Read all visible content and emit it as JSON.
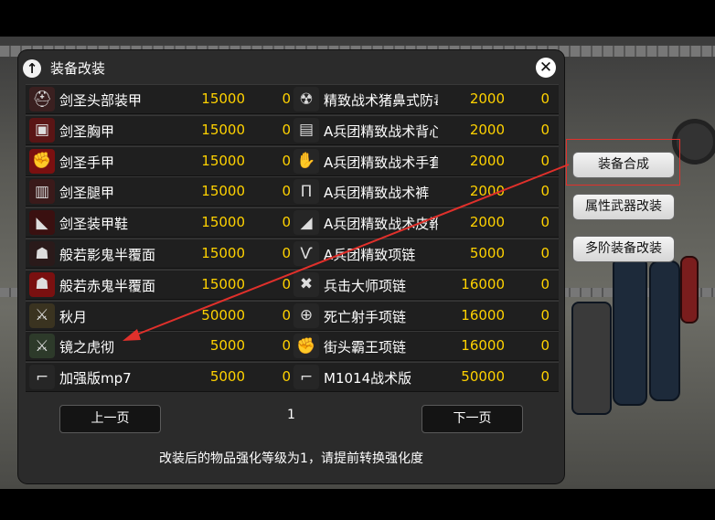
{
  "panel": {
    "title": "装备改装",
    "back_icon": "arrow-up-icon",
    "close_icon": "close-icon"
  },
  "left_items": [
    {
      "name": "剑圣头部装甲",
      "price": "15000",
      "count": "0",
      "icon": "helmet-icon"
    },
    {
      "name": "剑圣胸甲",
      "price": "15000",
      "count": "0",
      "icon": "chest-armor-icon"
    },
    {
      "name": "剑圣手甲",
      "price": "15000",
      "count": "0",
      "icon": "gauntlet-icon"
    },
    {
      "name": "剑圣腿甲",
      "price": "15000",
      "count": "0",
      "icon": "leg-armor-icon"
    },
    {
      "name": "剑圣装甲鞋",
      "price": "15000",
      "count": "0",
      "icon": "boots-icon"
    },
    {
      "name": "般若影鬼半覆面",
      "price": "15000",
      "count": "0",
      "icon": "mask-icon"
    },
    {
      "name": "般若赤鬼半覆面",
      "price": "15000",
      "count": "0",
      "icon": "red-mask-icon"
    },
    {
      "name": "秋月",
      "price": "50000",
      "count": "0",
      "icon": "sword-icon"
    },
    {
      "name": "镜之虎彻",
      "price": "5000",
      "count": "0",
      "icon": "katana-icon"
    },
    {
      "name": "加强版mp7",
      "price": "5000",
      "count": "0",
      "icon": "smg-icon"
    }
  ],
  "right_items": [
    {
      "name": "精致战术猪鼻式防毒",
      "price": "2000",
      "count": "0",
      "icon": "gas-mask-icon"
    },
    {
      "name": "A兵团精致战术背心",
      "price": "2000",
      "count": "0",
      "icon": "vest-icon"
    },
    {
      "name": "A兵团精致战术手套",
      "price": "2000",
      "count": "0",
      "icon": "glove-icon"
    },
    {
      "name": "A兵团精致战术裤",
      "price": "2000",
      "count": "0",
      "icon": "pants-icon"
    },
    {
      "name": "A兵团精致战术皮靴",
      "price": "2000",
      "count": "0",
      "icon": "tactical-boots-icon"
    },
    {
      "name": "A兵团精致项链",
      "price": "5000",
      "count": "0",
      "icon": "necklace-icon"
    },
    {
      "name": "兵击大师项链",
      "price": "16000",
      "count": "0",
      "icon": "crossed-swords-icon"
    },
    {
      "name": "死亡射手项链",
      "price": "16000",
      "count": "0",
      "icon": "crosshair-icon"
    },
    {
      "name": "街头霸王项链",
      "price": "16000",
      "count": "0",
      "icon": "fist-icon"
    },
    {
      "name": "M1014战术版",
      "price": "50000",
      "count": "0",
      "icon": "shotgun-icon"
    }
  ],
  "pagination": {
    "prev_label": "上一页",
    "next_label": "下一页",
    "current_page": "1"
  },
  "footer_note": "改装后的物品强化等级为1，请提前转换强化度",
  "side_menu": {
    "equip_synthesis": "装备合成",
    "weapon_mod": "属性武器改装",
    "multi_tier_mod": "多阶装备改装"
  },
  "colors": {
    "price": "#ffd200",
    "panel_bg": "#2b2b2b",
    "row_bg": "#1f1f1f",
    "annotation": "#e0302b"
  }
}
